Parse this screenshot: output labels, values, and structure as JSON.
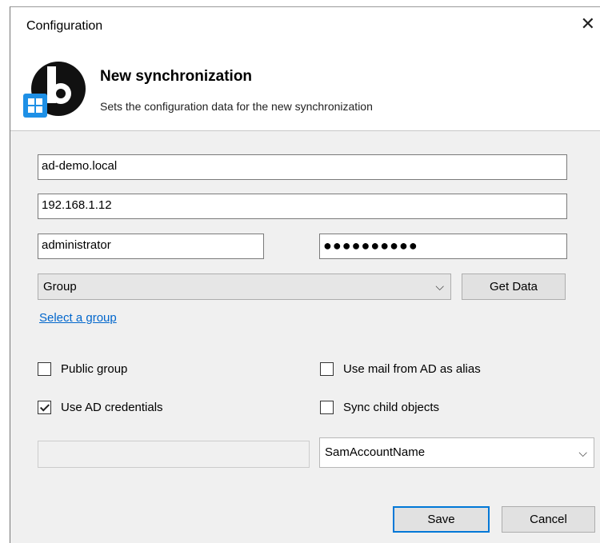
{
  "window": {
    "title": "Configuration",
    "close_glyph": "✕"
  },
  "header": {
    "title": "New synchronization",
    "subtitle": "Sets the configuration data for the new synchronization",
    "logo_icon": "b-sync-windows-logo-icon"
  },
  "form": {
    "domain_value": "ad-demo.local",
    "server_value": "192.168.1.12",
    "username_value": "administrator",
    "password_mask": "●●●●●●●●●●",
    "group_select_value": "Group",
    "get_data_label": "Get Data",
    "select_group_link": "Select a group",
    "disabled_input_value": "",
    "attribute_select_value": "SamAccountName"
  },
  "checkboxes": {
    "public_group": {
      "label": "Public group",
      "checked": false
    },
    "use_mail_alias": {
      "label": "Use mail from AD as alias",
      "checked": false
    },
    "use_ad_credentials": {
      "label": "Use AD credentials",
      "checked": true
    },
    "sync_child_objects": {
      "label": "Sync child objects",
      "checked": false
    }
  },
  "footer": {
    "save_label": "Save",
    "cancel_label": "Cancel"
  },
  "colors": {
    "accent": "#0078d7",
    "link": "#0066cc",
    "dialog_bg": "#f0f0f0"
  }
}
